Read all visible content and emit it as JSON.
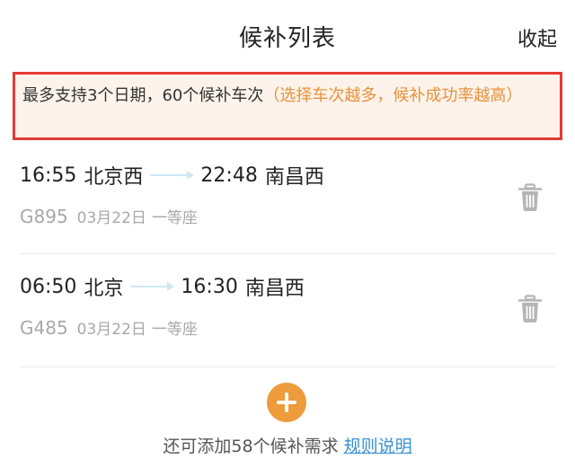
{
  "header": {
    "title": "候补列表",
    "collapse_label": "收起"
  },
  "notice": {
    "main_text": "最多支持3个日期，60个候补车次",
    "hint_text": "（选择车次越多，候补成功率越高）"
  },
  "trips": [
    {
      "depart_time": "16:55",
      "depart_station": "北京西",
      "arrive_time": "22:48",
      "arrive_station": "南昌西",
      "train_code": "G895",
      "date": "03月22日",
      "seat_class": "一等座"
    },
    {
      "depart_time": "06:50",
      "depart_station": "北京",
      "arrive_time": "16:30",
      "arrive_station": "南昌西",
      "train_code": "G485",
      "date": "03月22日",
      "seat_class": "一等座"
    }
  ],
  "footer": {
    "remaining_text": "还可添加58个候补需求",
    "rules_link": "规则说明"
  },
  "colors": {
    "accent": "#ee9b3c",
    "notice_border": "#e53935",
    "link": "#3a8fd6"
  }
}
